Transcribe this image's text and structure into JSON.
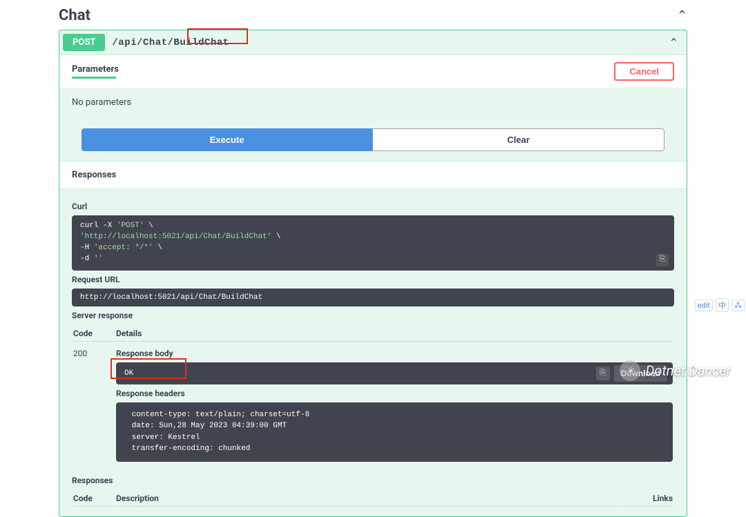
{
  "header": {
    "title": "Chat"
  },
  "operation": {
    "method": "POST",
    "path": "/api/Chat/BuildChat"
  },
  "parameters": {
    "title": "Parameters",
    "cancel": "Cancel",
    "none": "No parameters"
  },
  "actions": {
    "execute": "Execute",
    "clear": "Clear"
  },
  "responses": {
    "title": "Responses"
  },
  "curl": {
    "label": "Curl",
    "line1a": "curl -X ",
    "line1b": "'POST'",
    "line1c": " \\",
    "line2": "  'http://localhost:5021/api/Chat/BuildChat'",
    "line2b": " \\",
    "line3a": "  -H ",
    "line3b": "'accept: */*'",
    "line3c": " \\",
    "line4a": "  -d ",
    "line4b": "''"
  },
  "request_url": {
    "label": "Request URL",
    "value": "http://localhost:5021/api/Chat/BuildChat"
  },
  "server_response": {
    "label": "Server response",
    "code_h": "Code",
    "details_h": "Details",
    "code": "200",
    "body_label": "Response body",
    "body": "OK",
    "download": "Download",
    "headers_label": "Response headers",
    "headers": " content-type: text/plain; charset=utf-8 \n date: Sun,28 May 2023 04:39:00 GMT \n server: Kestrel \n transfer-encoding: chunked "
  },
  "responses_table": {
    "label": "Responses",
    "code_h": "Code",
    "desc_h": "Description",
    "links_h": "Links"
  },
  "watermark": "Dotnet Dancer",
  "sidetool": {
    "a": "edit",
    "b": "中",
    "c": "⁂"
  }
}
